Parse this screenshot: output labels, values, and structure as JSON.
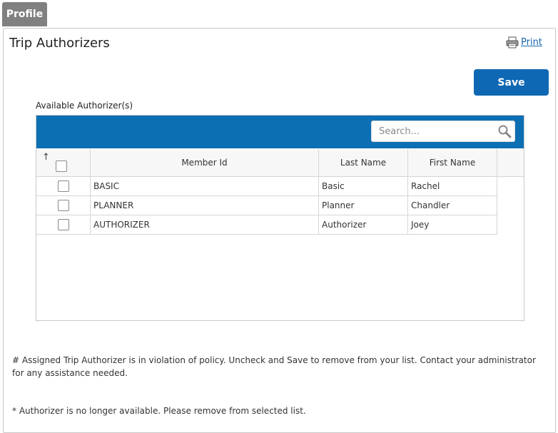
{
  "tab": {
    "label": "Profile"
  },
  "page": {
    "title": "Trip Authorizers",
    "print_label": "Print",
    "save_label": "Save"
  },
  "section": {
    "label": "Available Authorizer(s)"
  },
  "search": {
    "placeholder": "Search..."
  },
  "table": {
    "sort_indicator": "↑",
    "columns": [
      "Member Id",
      "Last Name",
      "First Name"
    ],
    "rows": [
      {
        "member_id": "BASIC",
        "last_name": "Basic",
        "first_name": "Rachel",
        "checked": false
      },
      {
        "member_id": "PLANNER",
        "last_name": "Planner",
        "first_name": "Chandler",
        "checked": false
      },
      {
        "member_id": "AUTHORIZER",
        "last_name": "Authorizer",
        "first_name": "Joey",
        "checked": false
      }
    ]
  },
  "notes": {
    "violation": "# Assigned Trip Authorizer is in violation of policy.  Uncheck and Save to remove from your list.  Contact your administrator for any assistance needed.",
    "unavailable": "* Authorizer is no longer available. Please remove from selected list."
  },
  "colors": {
    "header_bar": "#0d6fb3",
    "save_button": "#0f68b4",
    "tab": "#808080",
    "link": "#1565b0"
  }
}
